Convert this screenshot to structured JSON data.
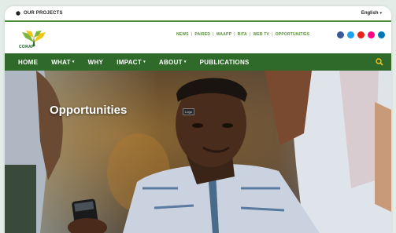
{
  "topbar": {
    "projects_label": "OUR PROJECTS",
    "language_label": "English",
    "caret": "▾"
  },
  "header": {
    "logo_text": "CORAF",
    "subnav": [
      "NEWS",
      "PAIRED",
      "WAAPP",
      "RITA",
      "WEB TV",
      "OPPORTUNITIES"
    ],
    "subnav_separator": "|",
    "social": [
      {
        "icon": "facebook-icon",
        "color": "#3b5998"
      },
      {
        "icon": "twitter-icon",
        "color": "#1da1f2"
      },
      {
        "icon": "youtube-icon",
        "color": "#e62117"
      },
      {
        "icon": "flickr-icon",
        "color": "#ff0084"
      },
      {
        "icon": "linkedin-icon",
        "color": "#0077b5"
      }
    ]
  },
  "nav": {
    "items": [
      {
        "label": "HOME",
        "dropdown": ""
      },
      {
        "label": "WHAT",
        "dropdown": "▾"
      },
      {
        "label": "WHY",
        "dropdown": ""
      },
      {
        "label": "IMPACT",
        "dropdown": "▾"
      },
      {
        "label": "ABOUT",
        "dropdown": "▾"
      },
      {
        "label": "PUBLICATIONS",
        "dropdown": ""
      }
    ]
  },
  "hero": {
    "title": "Opportunities",
    "tag": "Logo"
  },
  "colors": {
    "brand_green": "#2f6a2b",
    "accent_yellow": "#f2c418"
  }
}
